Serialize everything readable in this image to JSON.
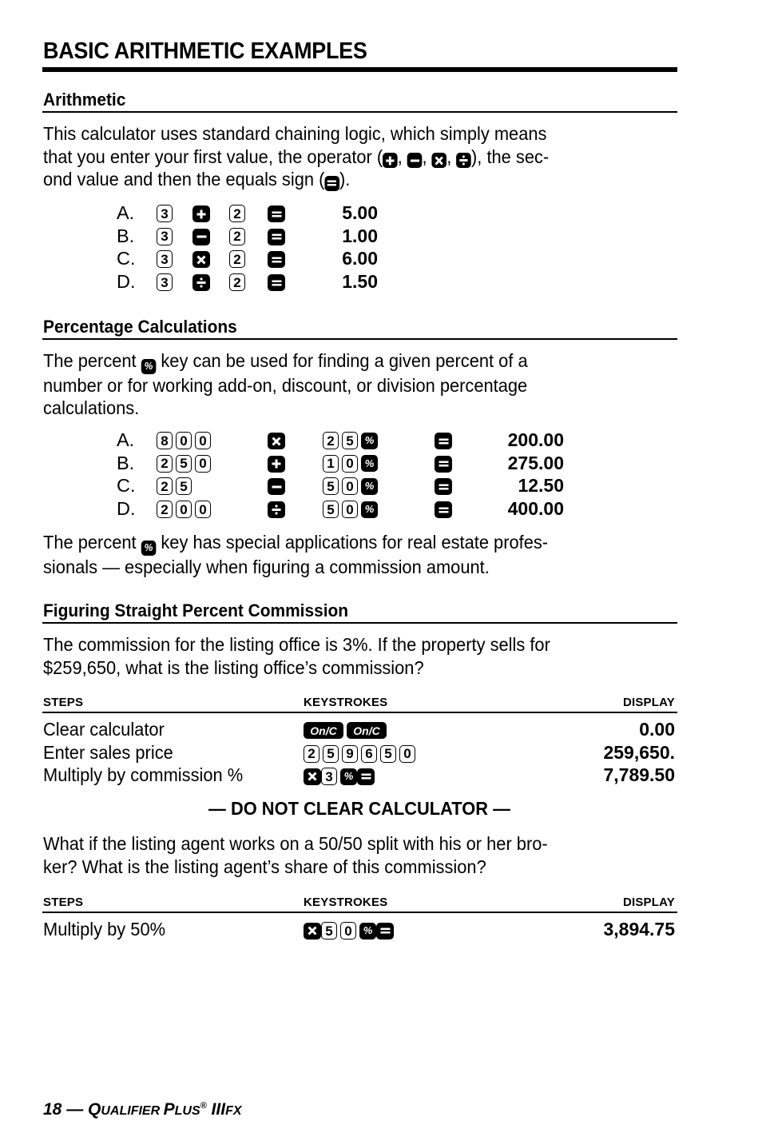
{
  "title": "BASIC ARITHMETIC EXAMPLES",
  "sections": {
    "arithmetic": {
      "heading": "Arithmetic",
      "paragraph": {
        "line1": "This calculator uses standard chaining logic, which simply means",
        "line2_a": "that you enter your first value, the operator (",
        "line2_sep": ", ",
        "line2_b": "), the sec-",
        "line3_a": "ond value and then the equals sign (",
        "line3_b": ")."
      },
      "examples": [
        {
          "label": "A.",
          "first": [
            "3"
          ],
          "operator": "plus",
          "second": [
            "2"
          ],
          "result": "5.00"
        },
        {
          "label": "B.",
          "first": [
            "3"
          ],
          "operator": "minus",
          "second": [
            "2"
          ],
          "result": "1.00"
        },
        {
          "label": "C.",
          "first": [
            "3"
          ],
          "operator": "times",
          "second": [
            "2"
          ],
          "result": "6.00"
        },
        {
          "label": "D.",
          "first": [
            "3"
          ],
          "operator": "divide",
          "second": [
            "2"
          ],
          "result": "1.50"
        }
      ]
    },
    "percentage": {
      "heading": "Percentage Calculations",
      "paragraph": {
        "line1_a": "The percent ",
        "line1_b": " key can be used for finding a given percent of a",
        "line2": "number or for working add-on, discount, or division percentage",
        "line3": "calculations."
      },
      "examples": [
        {
          "label": "A.",
          "first": [
            "8",
            "0",
            "0"
          ],
          "operator": "times",
          "second": [
            "2",
            "5"
          ],
          "result": "200.00"
        },
        {
          "label": "B.",
          "first": [
            "2",
            "5",
            "0"
          ],
          "operator": "plus",
          "second": [
            "1",
            "0"
          ],
          "result": "275.00"
        },
        {
          "label": "C.",
          "first": [
            "2",
            "5"
          ],
          "operator": "minus",
          "second": [
            "5",
            "0"
          ],
          "result": "12.50"
        },
        {
          "label": "D.",
          "first": [
            "2",
            "0",
            "0"
          ],
          "operator": "divide",
          "second": [
            "5",
            "0"
          ],
          "result": "400.00"
        }
      ],
      "note": {
        "line1_a": "The percent ",
        "line1_b": " key has special applications for real estate profes-",
        "line2": "sionals — especially when figuring a commission amount."
      }
    },
    "commission": {
      "heading": "Figuring Straight Percent Commission",
      "paragraph": {
        "line1": "The commission for the listing office is 3%. If the property sells for",
        "line2": "$259,650, what is the listing office’s commission?"
      },
      "table1": {
        "headers": {
          "steps": "STEPS",
          "keystrokes": "KEYSTROKES",
          "display": "DISPLAY"
        },
        "rows": [
          {
            "step": "Clear calculator",
            "keys": [
              {
                "type": "onc",
                "label": "On/C"
              },
              {
                "type": "onc",
                "label": "On/C"
              }
            ],
            "display": "0.00"
          },
          {
            "step": "Enter sales price",
            "keys": [
              {
                "type": "num",
                "label": "2"
              },
              {
                "type": "num",
                "label": "5"
              },
              {
                "type": "num",
                "label": "9"
              },
              {
                "type": "num",
                "label": "6"
              },
              {
                "type": "num",
                "label": "5"
              },
              {
                "type": "num",
                "label": "0"
              }
            ],
            "display": "259,650."
          },
          {
            "step": "Multiply by commission %",
            "keys": [
              {
                "type": "op",
                "label": "times"
              },
              {
                "type": "num",
                "label": "3"
              },
              {
                "type": "pct",
                "label": "%"
              },
              {
                "type": "op",
                "label": "equals"
              }
            ],
            "display": "7,789.50"
          }
        ]
      },
      "do_not_clear": "— DO NOT CLEAR CALCULATOR —",
      "paragraph2": {
        "line1": "What if the listing agent works on a 50/50 split with his or her bro-",
        "line2": "ker? What is the listing agent’s share of this commission?"
      },
      "table2": {
        "headers": {
          "steps": "STEPS",
          "keystrokes": "KEYSTROKES",
          "display": "DISPLAY"
        },
        "rows": [
          {
            "step": "Multiply by 50%",
            "keys": [
              {
                "type": "op",
                "label": "times"
              },
              {
                "type": "num",
                "label": "5"
              },
              {
                "type": "num",
                "label": "0"
              },
              {
                "type": "pct",
                "label": "%"
              },
              {
                "type": "op",
                "label": "equals"
              }
            ],
            "display": "3,894.75"
          }
        ]
      }
    }
  },
  "keys": {
    "percent": "%",
    "on_clear": "On/C"
  },
  "footer": {
    "page": "18 — ",
    "q": "Q",
    "ualifier": "UALIFIER ",
    "p": "P",
    "lus": "LUS",
    "reg": "®",
    "model_a": " III",
    "model_b": "FX"
  }
}
